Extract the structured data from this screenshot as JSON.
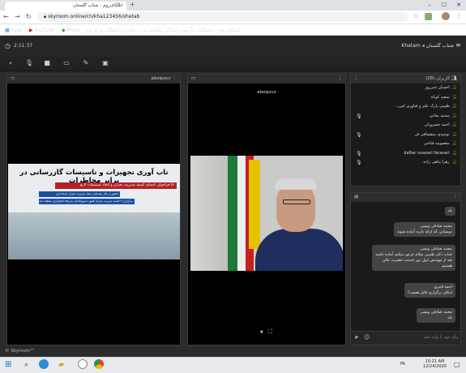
{
  "browser": {
    "tab_title": "اسکای‌روم - شتاب گلستان",
    "url": "skyroom.online/ch/kha123456/shetab",
    "bookmarks": [
      "Apps",
      "YouTube",
      "Maps",
      "تجارب دانشگاه مرکز مح...",
      "آزمون آمادگی مقاصد نب...",
      "اسکای‌روم - دانشگاه..."
    ]
  },
  "header": {
    "room_title": "Khatam ◂ شتاب گلستان",
    "timer": "2:11:37"
  },
  "slides_panel": {
    "name": "abolpour",
    "slide_title": "تاب آوری تجهیزات و تاسیسات گازرسانی در برابر مخاطرات",
    "slide_subtitle": "۲) فراخوان اعضای کمیته مدیریت بحران و اتخاذ تصمیمات لازم",
    "slide_line1": "حضور در فاز مقدماتی ستاد مدیریت بحران استانداری",
    "slide_line2": "برگزاری ۳ جلسه مدیریت بحران طبق دستورالعمل شرایط اضطراری منطقه ۸ند"
  },
  "video_panel": {
    "name": "abolpour",
    "video_label": "abolpour"
  },
  "users_panel": {
    "title": "کاربران (28)",
    "users": [
      {
        "name": "احسان چترروز",
        "mic": false
      },
      {
        "name": "سعید کوتاه",
        "mic": false
      },
      {
        "name": "طبیبی پارک علم و فناوری اس...",
        "mic": false
      },
      {
        "name": "محمد نجاتی",
        "mic": true
      },
      {
        "name": "احمد خسروبان",
        "mic": false
      },
      {
        "name": "توحیدی منقشافی فر",
        "mic": true
      },
      {
        "name": "معصومه فتاحی",
        "mic": false
      },
      {
        "name": "daftar noavari faravari",
        "mic": true
      },
      {
        "name": "زهرا پناهی زاده",
        "mic": true
      }
    ]
  },
  "chat_panel": {
    "messages": [
      {
        "text": "بله"
      },
      {
        "text": "محمد صادقی ویسی\nدوستانی که ارائه دارند آماده شوند"
      },
      {
        "text": "محمد صادقی ویسی\nجناب دکتر طبیبی سلام عرض میکنم آماده باشید\nبعد از مهندس ابول پور خدمت حضرت عالی\nهستیم"
      },
      {
        "text": "احمد قنبری\nامکان برگزاری فایل هست؟"
      },
      {
        "text": "محمد صادقی ویسی\nبله"
      }
    ],
    "input_placeholder": "پیام خود را وارد کنید"
  },
  "footer": {
    "brand": "© Skyroom™"
  },
  "taskbar": {
    "time": "10:21 AM",
    "date": "12/24/2020",
    "lang": "FA"
  },
  "colors": {
    "accent": "#e6c200",
    "slide_bar": "#1e4f9e",
    "slide_red": "#b0232a"
  }
}
